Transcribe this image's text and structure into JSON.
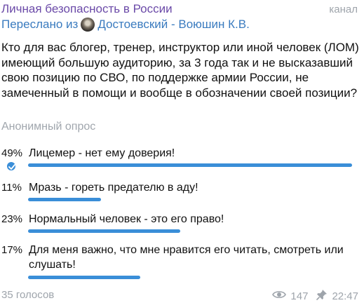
{
  "header": {
    "channel_name": "Личная безопасность в России",
    "channel_tag": "канал",
    "forwarded_prefix": "Переслано из",
    "forwarded_source": "Достоевский - Воюшин К.В."
  },
  "poll": {
    "question": "Кто для вас блогер, тренер, инструктор или иной человек (ЛОМ) имеющий большую аудиторию, за 3 года так и не высказавший свою позицию по СВО, по поддержке армии России, не замеченный в помощи и вообще в обозначении своей позиции?",
    "type_label": "Анонимный опрос",
    "options": [
      {
        "percent": "49%",
        "text": "Лицемер - нет ему доверия!",
        "fraction": 0.49,
        "selected": true
      },
      {
        "percent": "11%",
        "text": "Мразь - гореть предателю в аду!",
        "fraction": 0.11,
        "selected": false
      },
      {
        "percent": "23%",
        "text": "Нормальный человек - это его право!",
        "fraction": 0.23,
        "selected": false
      },
      {
        "percent": "17%",
        "text": "Для меня важно, что мне нравится его читать, смотреть или слушать!",
        "fraction": 0.17,
        "selected": false
      }
    ],
    "votes_label": "35 голосов"
  },
  "footer": {
    "views": "147",
    "time": "22:47"
  },
  "colors": {
    "accent": "#3a8ed8",
    "channel": "#6b4aa8",
    "link": "#3a7bbf",
    "muted": "#9ea4ab"
  },
  "icons": {
    "views": "eye-icon",
    "pin": "pin-icon",
    "check": "check-icon",
    "avatar": "avatar"
  }
}
